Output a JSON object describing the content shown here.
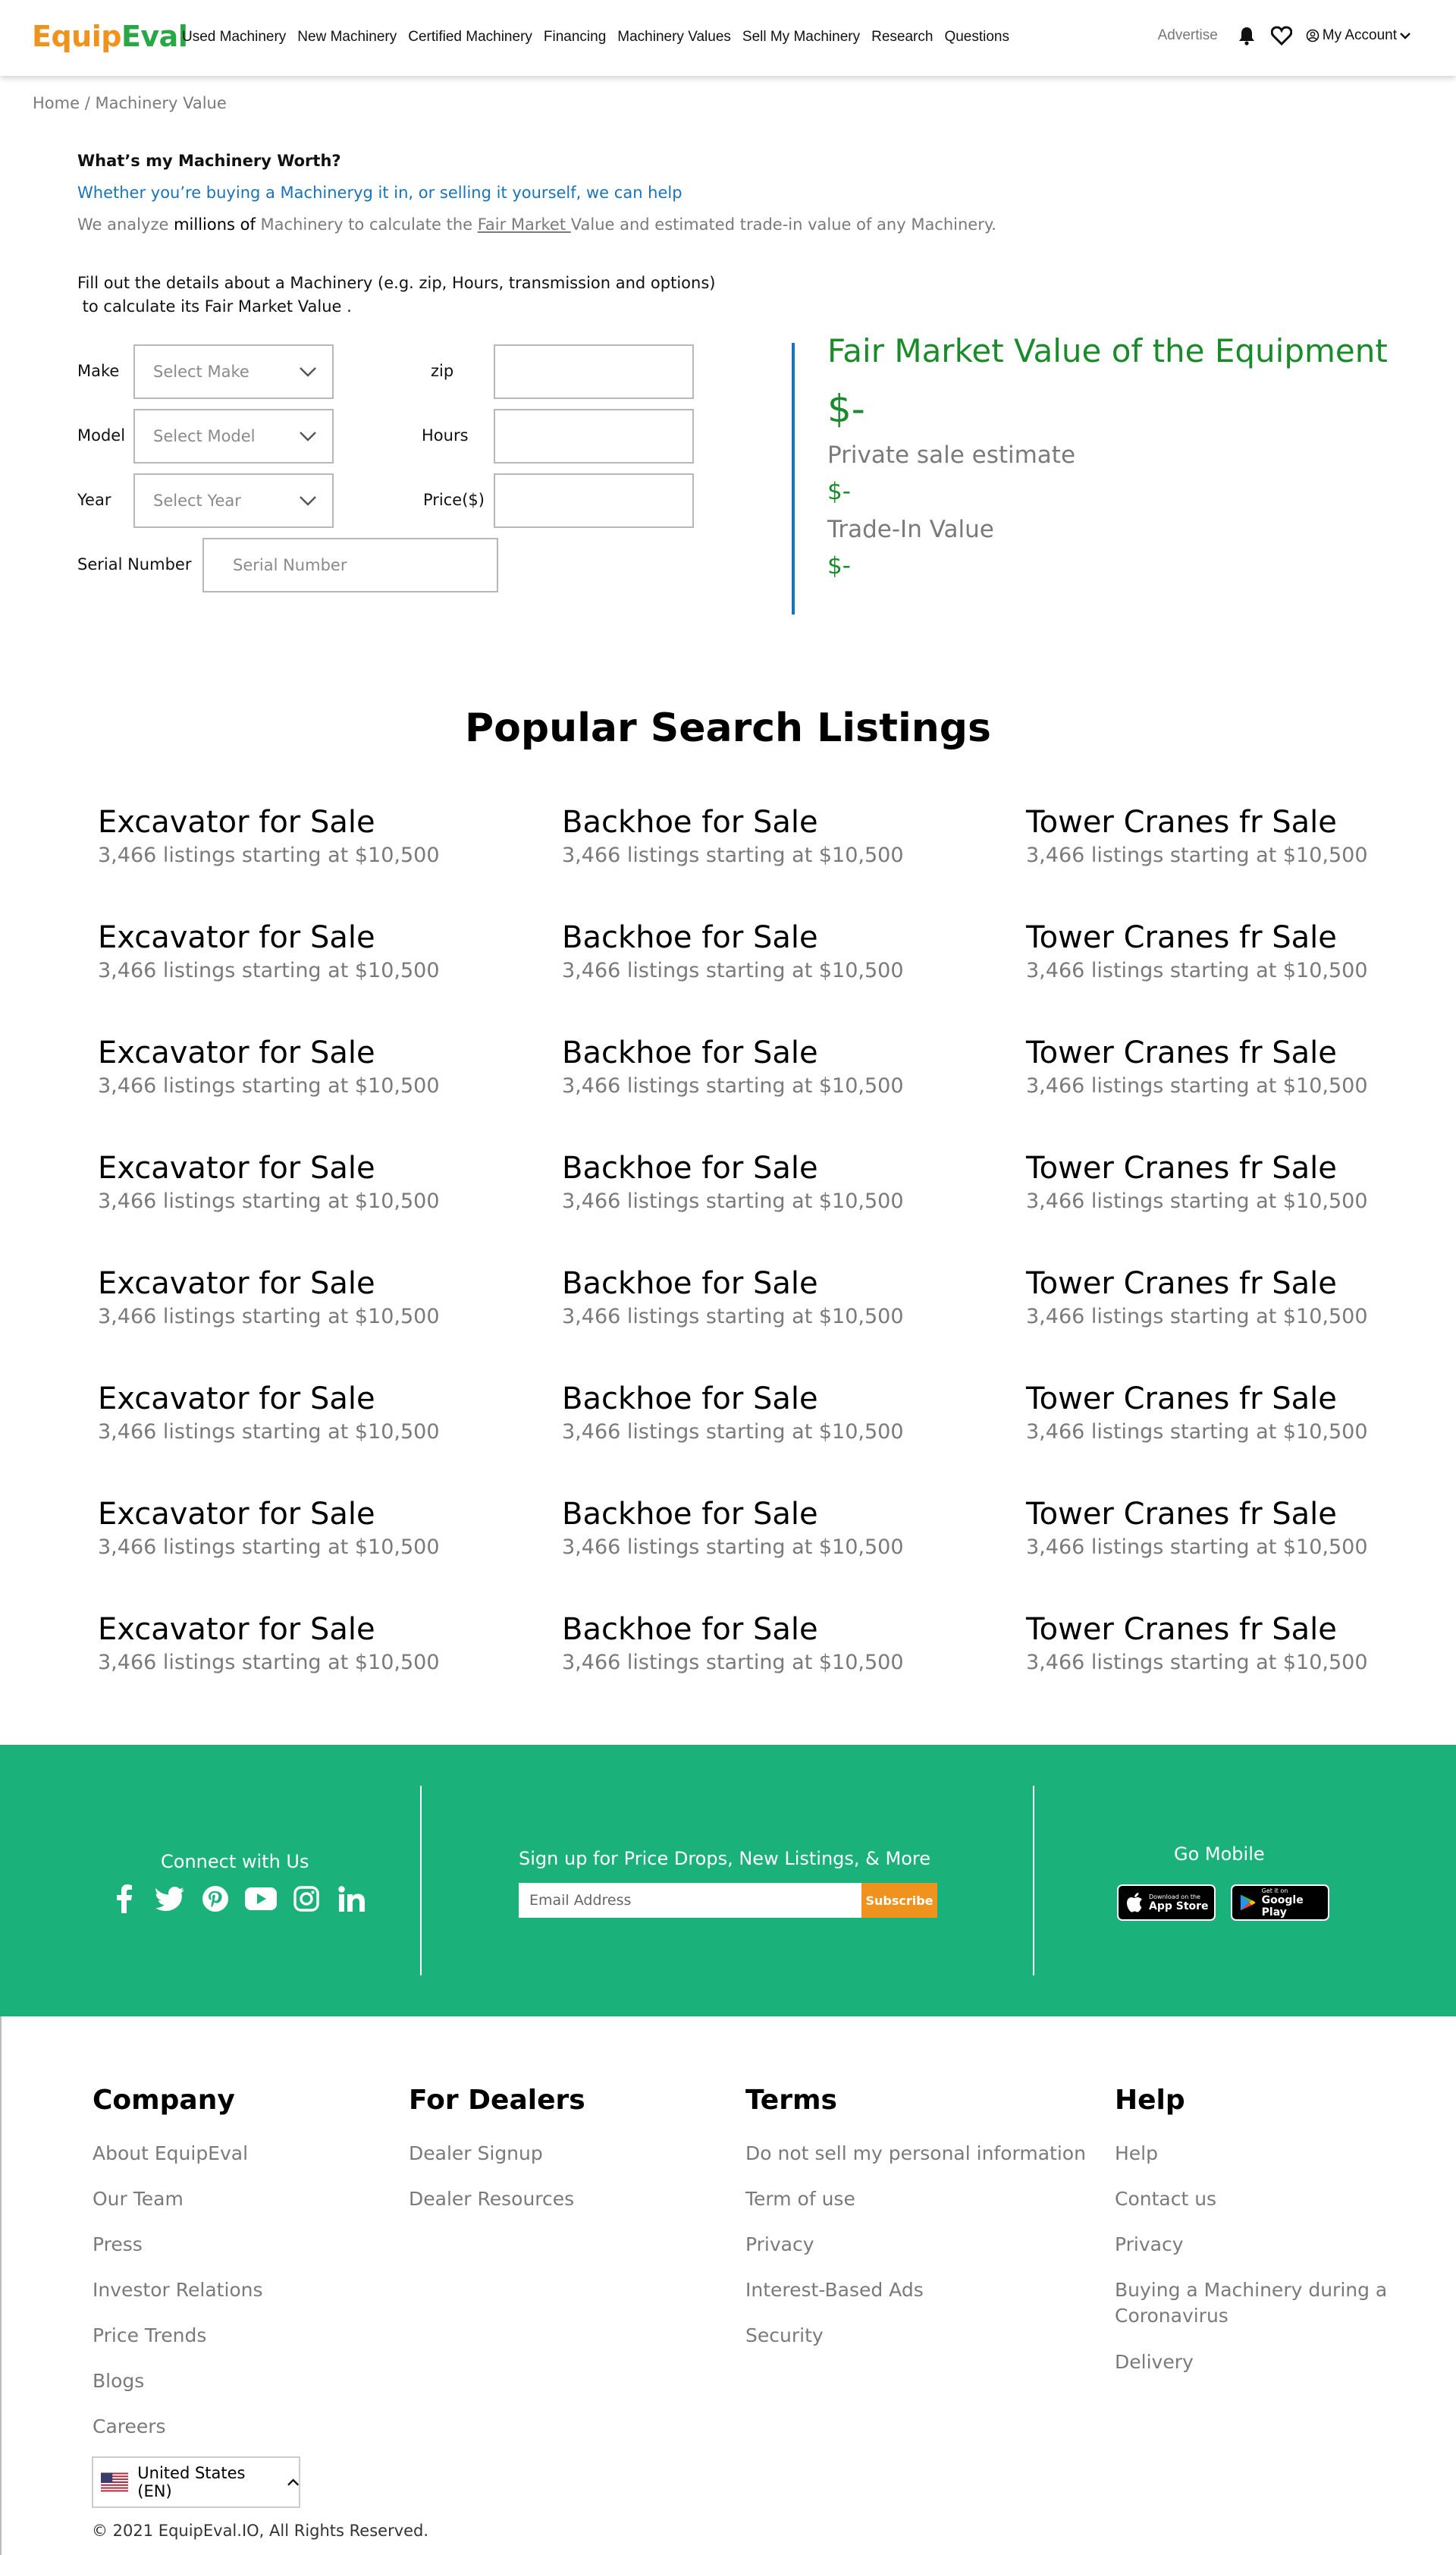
{
  "brand": {
    "part1": "Equip",
    "part2": "Eval",
    "orange": "#f0931e",
    "green": "#2aa745"
  },
  "nav": {
    "links": [
      "Used Machinery",
      "New Machinery",
      "Certified Machinery",
      "Financing",
      "Machinery Values",
      "Sell My Machinery",
      "Research",
      "Questions"
    ],
    "advertise": "Advertise",
    "account": "My Account",
    "icons": [
      "bell-icon",
      "heart-icon",
      "user-circle-icon",
      "chevron-down-icon"
    ]
  },
  "breadcrumb": {
    "home": "Home",
    "separator": "/",
    "current": "Machinery Value"
  },
  "intro": {
    "title": "What’s my Machinery Worth?",
    "subtitle": "Whether you’re buying a Machineryg it in, or selling it yourself, we can help",
    "desc_1": "We analyze ",
    "desc_bold": "millions of",
    "desc_2": " Machinery to calculate the ",
    "desc_link": "Fair Market ",
    "desc_3": "Value and estimated trade-in value of any Machinery."
  },
  "instructions": {
    "line1": "Fill out the details about a Machinery (e.g. zip, Hours, transmission and options)",
    "line2": " to calculate its Fair Market Value ."
  },
  "form": {
    "make_label": "Make",
    "make_placeholder": "Select Make",
    "model_label": "Model",
    "model_placeholder": "Select Model",
    "year_label": "Year",
    "year_placeholder": "Select Year",
    "zip_label": "zip",
    "zip_value": "",
    "hours_label": "Hours",
    "hours_value": "",
    "price_label": "Price($)",
    "price_value": "",
    "serial_label": "Serial Number",
    "serial_placeholder": "Serial Number"
  },
  "valuation": {
    "title": "Fair Market Value of the Equipment",
    "fmv": "$-",
    "private_label": "Private sale estimate",
    "private_value": "$-",
    "tradein_label": "Trade-In Value",
    "tradein_value": "$-",
    "accent": "#1a8a2a",
    "divider": "#1a73b8"
  },
  "popular": {
    "title": "Popular Search Listings",
    "items": [
      {
        "title": "Excavator for Sale",
        "sub": "3,466 listings starting at $10,500"
      },
      {
        "title": "Backhoe for Sale",
        "sub": "3,466 listings starting at $10,500"
      },
      {
        "title": "Tower Cranes fr Sale",
        "sub": "3,466 listings starting at $10,500"
      },
      {
        "title": "Excavator for Sale",
        "sub": "3,466 listings starting at $10,500"
      },
      {
        "title": "Backhoe for Sale",
        "sub": "3,466 listings starting at $10,500"
      },
      {
        "title": "Tower Cranes fr Sale",
        "sub": "3,466 listings starting at $10,500"
      },
      {
        "title": "Excavator for Sale",
        "sub": "3,466 listings starting at $10,500"
      },
      {
        "title": "Backhoe for Sale",
        "sub": "3,466 listings starting at $10,500"
      },
      {
        "title": "Tower Cranes fr Sale",
        "sub": "3,466 listings starting at $10,500"
      },
      {
        "title": "Excavator for Sale",
        "sub": "3,466 listings starting at $10,500"
      },
      {
        "title": "Backhoe for Sale",
        "sub": "3,466 listings starting at $10,500"
      },
      {
        "title": "Tower Cranes fr Sale",
        "sub": "3,466 listings starting at $10,500"
      },
      {
        "title": "Excavator for Sale",
        "sub": "3,466 listings starting at $10,500"
      },
      {
        "title": "Backhoe for Sale",
        "sub": "3,466 listings starting at $10,500"
      },
      {
        "title": "Tower Cranes fr Sale",
        "sub": "3,466 listings starting at $10,500"
      },
      {
        "title": "Excavator for Sale",
        "sub": "3,466 listings starting at $10,500"
      },
      {
        "title": "Backhoe for Sale",
        "sub": "3,466 listings starting at $10,500"
      },
      {
        "title": "Tower Cranes fr Sale",
        "sub": "3,466 listings starting at $10,500"
      },
      {
        "title": "Excavator for Sale",
        "sub": "3,466 listings starting at $10,500"
      },
      {
        "title": "Backhoe for Sale",
        "sub": "3,466 listings starting at $10,500"
      },
      {
        "title": "Tower Cranes fr Sale",
        "sub": "3,466 listings starting at $10,500"
      },
      {
        "title": "Excavator for Sale",
        "sub": "3,466 listings starting at $10,500"
      },
      {
        "title": "Backhoe for Sale",
        "sub": "3,466 listings starting at $10,500"
      },
      {
        "title": "Tower Cranes fr Sale",
        "sub": "3,466 listings starting at $10,500"
      }
    ]
  },
  "band": {
    "color": "#1bb17a",
    "connect_title": "Connect with Us",
    "social_icons": [
      "facebook-icon",
      "twitter-icon",
      "pinterest-icon",
      "youtube-icon",
      "instagram-icon",
      "linkedin-icon"
    ],
    "signup_title": "Sign up for Price Drops, New Listings, & More",
    "email_placeholder": "Email Address",
    "subscribe_label": "Subscribe",
    "mobile_title": "Go Mobile",
    "appstore_small": "Download on the",
    "appstore_big": "App Store",
    "play_small": "Get it on",
    "play_big": "Google Play"
  },
  "footer": {
    "company": {
      "title": "Company",
      "links": [
        "About EquipEval",
        "Our Team",
        "Press",
        "Investor Relations",
        "Price Trends",
        "Blogs",
        "Careers"
      ]
    },
    "dealers": {
      "title": "For Dealers",
      "links": [
        "Dealer Signup",
        "Dealer Resources"
      ]
    },
    "terms": {
      "title": "Terms",
      "links": [
        "Do not sell my personal information",
        "Term of use",
        "Privacy",
        "Interest-Based Ads",
        "Security"
      ]
    },
    "help": {
      "title": "Help",
      "links": [
        "Help",
        "Contact us",
        "Privacy",
        "Buying a Machinery during a Coronavirus",
        "Delivery"
      ]
    },
    "country": "United States (EN)",
    "copyright": "© 2021 EquipEval.IO, All Rights Reserved."
  }
}
